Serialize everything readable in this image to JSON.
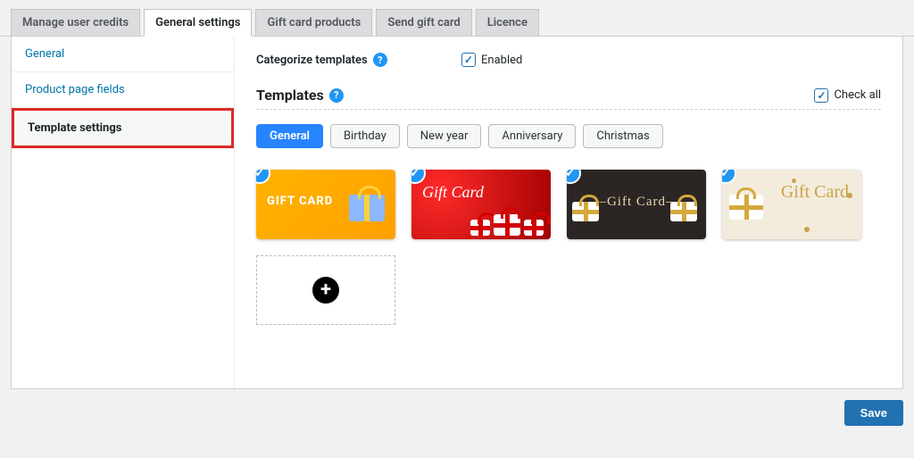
{
  "tabs": [
    {
      "label": "Manage user credits",
      "active": false
    },
    {
      "label": "General settings",
      "active": true
    },
    {
      "label": "Gift card products",
      "active": false
    },
    {
      "label": "Send gift card",
      "active": false
    },
    {
      "label": "Licence",
      "active": false
    }
  ],
  "sidebar": [
    {
      "label": "General",
      "active": false
    },
    {
      "label": "Product page fields",
      "active": false
    },
    {
      "label": "Template settings",
      "active": true
    }
  ],
  "categorize": {
    "label": "Categorize templates",
    "enabled_label": "Enabled",
    "enabled": true
  },
  "templates_section": {
    "title": "Templates",
    "check_all_label": "Check all",
    "check_all": true
  },
  "categories": [
    {
      "label": "General",
      "active": true
    },
    {
      "label": "Birthday",
      "active": false
    },
    {
      "label": "New year",
      "active": false
    },
    {
      "label": "Anniversary",
      "active": false
    },
    {
      "label": "Christmas",
      "active": false
    }
  ],
  "cards": [
    {
      "variant": "yellow",
      "text": "GIFT CARD",
      "selected": true
    },
    {
      "variant": "red",
      "text": "Gift\nCard",
      "selected": true
    },
    {
      "variant": "dark",
      "text": "–Gift Card–",
      "selected": true
    },
    {
      "variant": "cream",
      "text": "Gift\nCard",
      "selected": true
    }
  ],
  "save_label": "Save"
}
